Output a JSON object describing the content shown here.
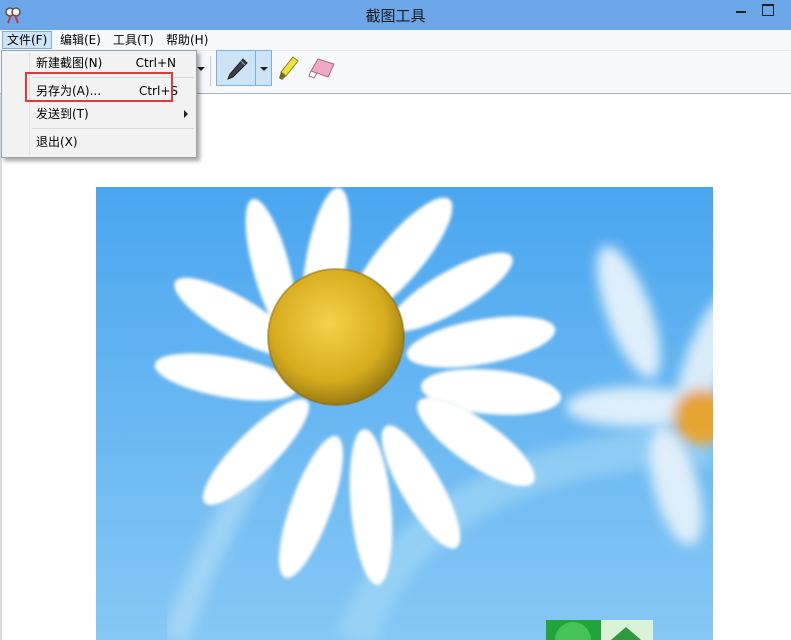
{
  "window": {
    "title": "截图工具"
  },
  "menubar": {
    "items": [
      {
        "label": "文件(F)"
      },
      {
        "label": "编辑(E)"
      },
      {
        "label": "工具(T)"
      },
      {
        "label": "帮助(H)"
      }
    ]
  },
  "file_menu": {
    "items": [
      {
        "label": "新建截图(N)",
        "shortcut": "Ctrl+N"
      },
      {
        "label": "另存为(A)...",
        "shortcut": "Ctrl+S"
      },
      {
        "label": "发送到(T)",
        "shortcut": ""
      },
      {
        "label": "退出(X)",
        "shortcut": ""
      }
    ]
  },
  "toolbar": {
    "icons": [
      "pen-icon",
      "highlighter-icon",
      "eraser-icon"
    ]
  },
  "colors": {
    "titlebar": "#6ba6e8",
    "highlight": "#e03a3a",
    "selected": "#cde4f7"
  }
}
